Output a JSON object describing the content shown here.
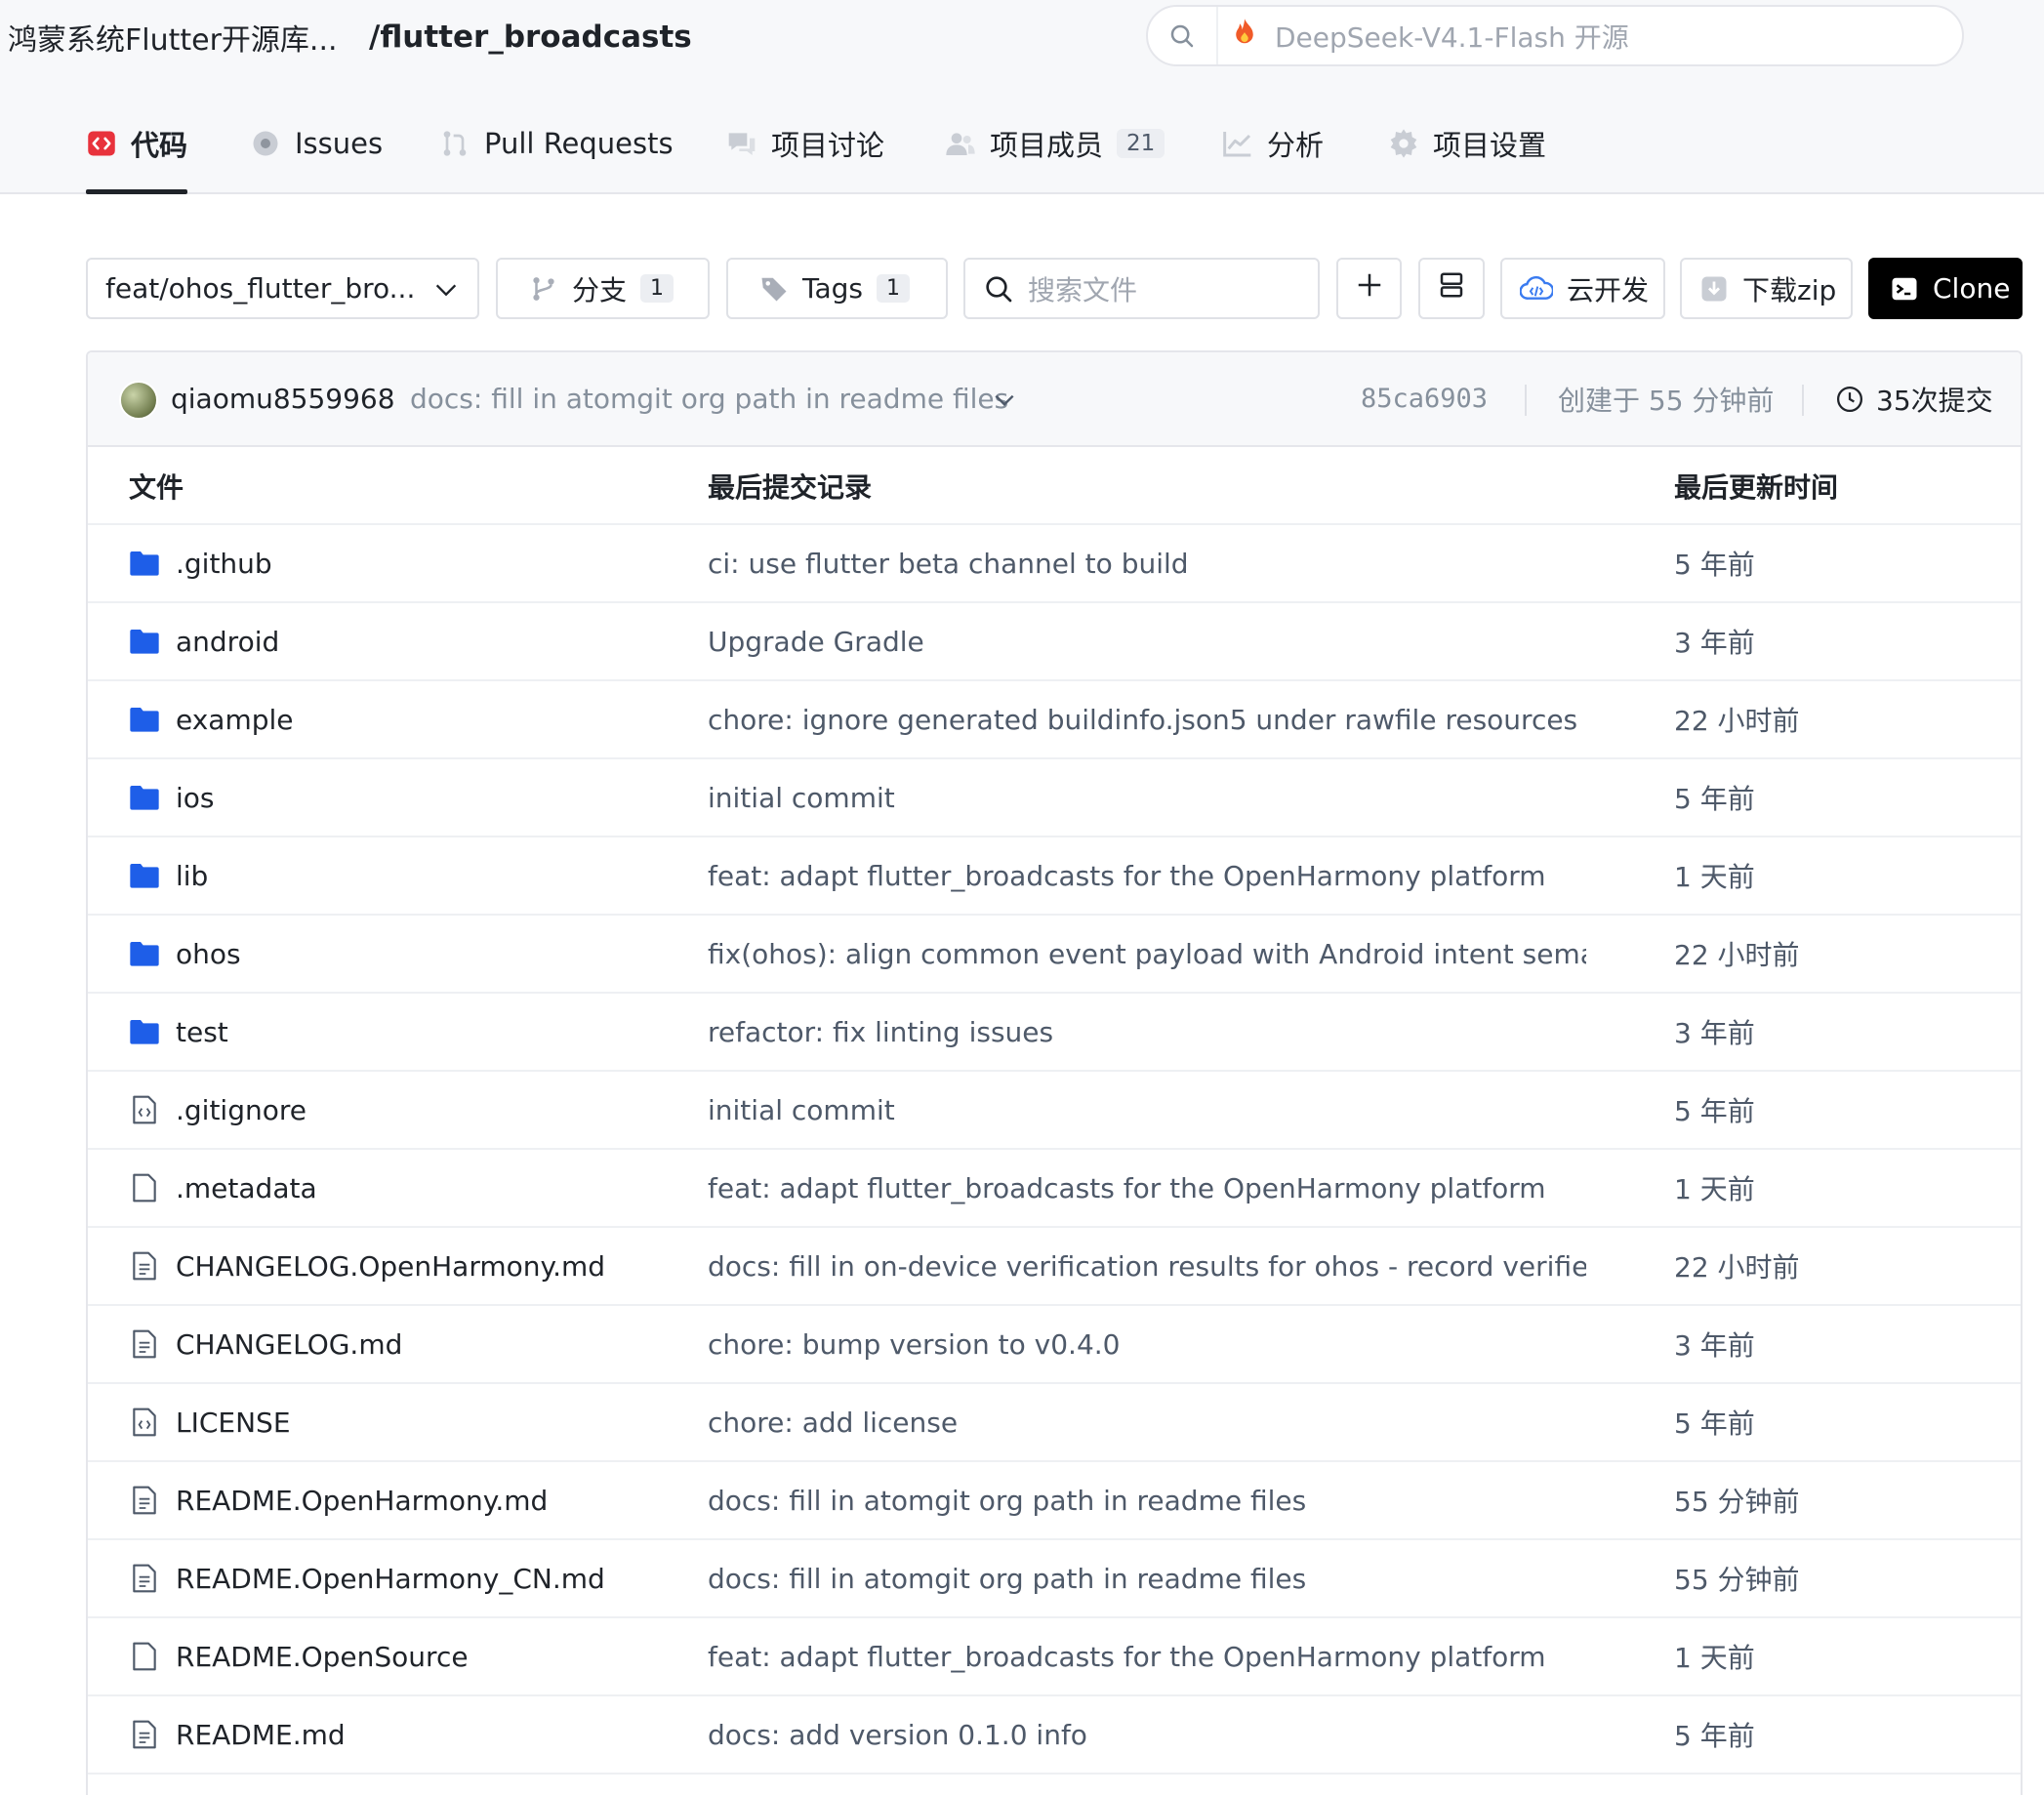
{
  "breadcrumb": {
    "org": "鸿蒙系统Flutter开源库...",
    "repo": "/flutter_broadcasts"
  },
  "search": {
    "placeholder": "DeepSeek-V4.1-Flash 开源"
  },
  "tabs": [
    {
      "label": "代码",
      "icon": "code-icon",
      "active": true
    },
    {
      "label": "Issues",
      "icon": "issues-icon"
    },
    {
      "label": "Pull Requests",
      "icon": "pull-request-icon"
    },
    {
      "label": "项目讨论",
      "icon": "discussion-icon"
    },
    {
      "label": "项目成员",
      "icon": "members-icon",
      "badge": "21"
    },
    {
      "label": "分析",
      "icon": "analytics-icon"
    },
    {
      "label": "项目设置",
      "icon": "settings-icon"
    }
  ],
  "toolbar": {
    "branch": "feat/ohos_flutter_bro...",
    "branches_label": "分支",
    "branches_count": "1",
    "tags_label": "Tags",
    "tags_count": "1",
    "file_search_placeholder": "搜索文件",
    "cloud_label": "云开发",
    "zip_label": "下载zip",
    "clone_label": "Clone"
  },
  "last_commit": {
    "user": "qiaomu8559968",
    "message": "docs: fill in atomgit org path in readme files",
    "hash": "85ca6903",
    "created": "创建于 55 分钟前",
    "commits": "35次提交"
  },
  "table": {
    "headers": [
      "文件",
      "最后提交记录",
      "最后更新时间"
    ],
    "rows": [
      {
        "name": ".github",
        "type": "folder",
        "message": "ci: use flutter beta channel to build",
        "time": "5 年前"
      },
      {
        "name": "android",
        "type": "folder",
        "message": "Upgrade Gradle",
        "time": "3 年前"
      },
      {
        "name": "example",
        "type": "folder",
        "message": "chore: ignore generated buildinfo.json5 under rawfile resources",
        "time": "22 小时前"
      },
      {
        "name": "ios",
        "type": "folder",
        "message": "initial commit",
        "time": "5 年前"
      },
      {
        "name": "lib",
        "type": "folder",
        "message": "feat: adapt flutter_broadcasts for the OpenHarmony platform",
        "time": "1 天前"
      },
      {
        "name": "ohos",
        "type": "folder",
        "message": "fix(ohos): align common event payload with Android intent semanti...",
        "time": "22 小时前"
      },
      {
        "name": "test",
        "type": "folder",
        "message": "refactor: fix linting issues",
        "time": "3 年前"
      },
      {
        "name": ".gitignore",
        "type": "code",
        "message": "initial commit",
        "time": "5 年前"
      },
      {
        "name": ".metadata",
        "type": "file",
        "message": "feat: adapt flutter_broadcasts for the OpenHarmony platform",
        "time": "1 天前"
      },
      {
        "name": "CHANGELOG.OpenHarmony.md",
        "type": "doc",
        "message": "docs: fill in on-device verification results for ohos - record verified...",
        "time": "22 小时前"
      },
      {
        "name": "CHANGELOG.md",
        "type": "doc",
        "message": "chore: bump version to v0.4.0",
        "time": "3 年前"
      },
      {
        "name": "LICENSE",
        "type": "code",
        "message": "chore: add license",
        "time": "5 年前"
      },
      {
        "name": "README.OpenHarmony.md",
        "type": "doc",
        "message": "docs: fill in atomgit org path in readme files",
        "time": "55 分钟前"
      },
      {
        "name": "README.OpenHarmony_CN.md",
        "type": "doc",
        "message": "docs: fill in atomgit org path in readme files",
        "time": "55 分钟前"
      },
      {
        "name": "README.OpenSource",
        "type": "file",
        "message": "feat: adapt flutter_broadcasts for the OpenHarmony platform",
        "time": "1 天前"
      },
      {
        "name": "README.md",
        "type": "doc",
        "message": "docs: add version 0.1.0 info",
        "time": "5 年前"
      }
    ]
  },
  "colors": {
    "accent_red": "#e8323c",
    "folder_blue": "#1e5ee8",
    "clone_bg": "#000000"
  }
}
